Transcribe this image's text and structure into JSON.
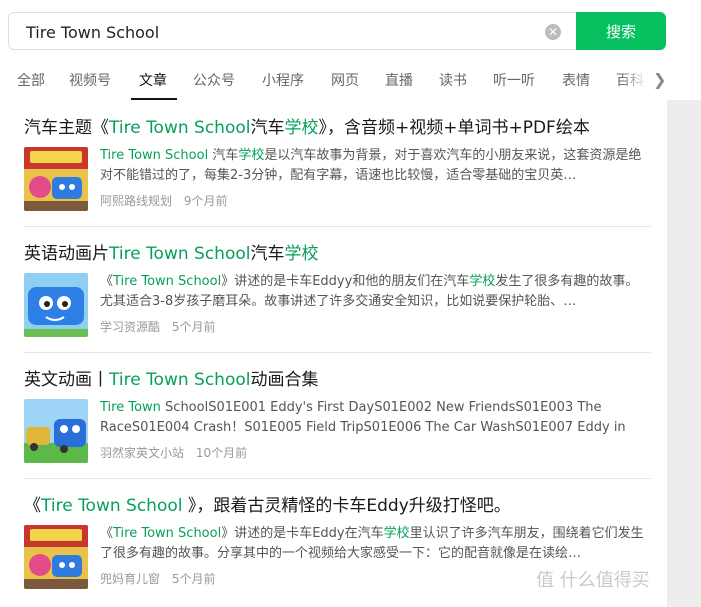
{
  "search": {
    "value": "Tire Town School",
    "button_label": "搜索"
  },
  "tabs": [
    "全部",
    "视频号",
    "文章",
    "公众号",
    "小程序",
    "网页",
    "直播",
    "读书",
    "听一听",
    "表情",
    "百科"
  ],
  "results": [
    {
      "title_parts": [
        {
          "t": "汽车主题《"
        },
        {
          "t": "Tire Town School",
          "hl": true
        },
        {
          "t": "汽车"
        },
        {
          "t": "学校",
          "hl": true
        },
        {
          "t": "》，含音频+视频+单词书+PDF绘本"
        }
      ],
      "snippet_parts": [
        {
          "t": "Tire Town School",
          "hl": true
        },
        {
          "t": " 汽车"
        },
        {
          "t": "学校",
          "hl": true
        },
        {
          "t": "是以汽车故事为背景，对于喜欢汽车的小朋友来说，这套资源是绝对不能错过的了，每集2-3分钟，配有字幕，语速也比较慢，适合零基础的宝贝英…"
        }
      ],
      "source": "阿熙路线规划",
      "time": "9个月前"
    },
    {
      "title_parts": [
        {
          "t": "英语动画片"
        },
        {
          "t": "Tire Town School",
          "hl": true
        },
        {
          "t": "汽车"
        },
        {
          "t": "学校",
          "hl": true
        }
      ],
      "snippet_parts": [
        {
          "t": "《"
        },
        {
          "t": "Tire Town School",
          "hl": true
        },
        {
          "t": "》讲述的是卡车Eddyy和他的朋友们在汽车"
        },
        {
          "t": "学校",
          "hl": true
        },
        {
          "t": "发生了很多有趣的故事。尤其适合3-8岁孩子磨耳朵。故事讲述了许多交通安全知识，比如说要保护轮胎、…"
        }
      ],
      "source": "学习资源酷",
      "time": "5个月前"
    },
    {
      "title_parts": [
        {
          "t": "英文动画丨"
        },
        {
          "t": "Tire Town School",
          "hl": true
        },
        {
          "t": "动画合集"
        }
      ],
      "snippet_parts": [
        {
          "t": "Tire Town",
          "hl": true
        },
        {
          "t": " SchoolS01E001 Eddy's First DayS01E002 New FriendsS01E003 The RaceS01E004 Crash！S01E005 Field TripS01E006 The Car WashS01E007 Eddy in the Car …"
        }
      ],
      "source": "羽然家英文小站",
      "time": "10个月前"
    },
    {
      "title_parts": [
        {
          "t": "《"
        },
        {
          "t": "Tire Town School ",
          "hl": true
        },
        {
          "t": "》，跟着古灵精怪的卡车Eddy升级打怪吧。"
        }
      ],
      "snippet_parts": [
        {
          "t": "《"
        },
        {
          "t": "Tire Town School",
          "hl": true
        },
        {
          "t": "》讲述的是卡车Eddy在汽车"
        },
        {
          "t": "学校",
          "hl": true
        },
        {
          "t": "里认识了许多汽车朋友，围绕着它们发生了很多有趣的故事。分享其中的一个视频给大家感受一下：它的配音就像是在读绘…"
        }
      ],
      "source": "兜妈育儿窗",
      "time": "5个月前"
    }
  ],
  "watermark": "值 什么值得买"
}
